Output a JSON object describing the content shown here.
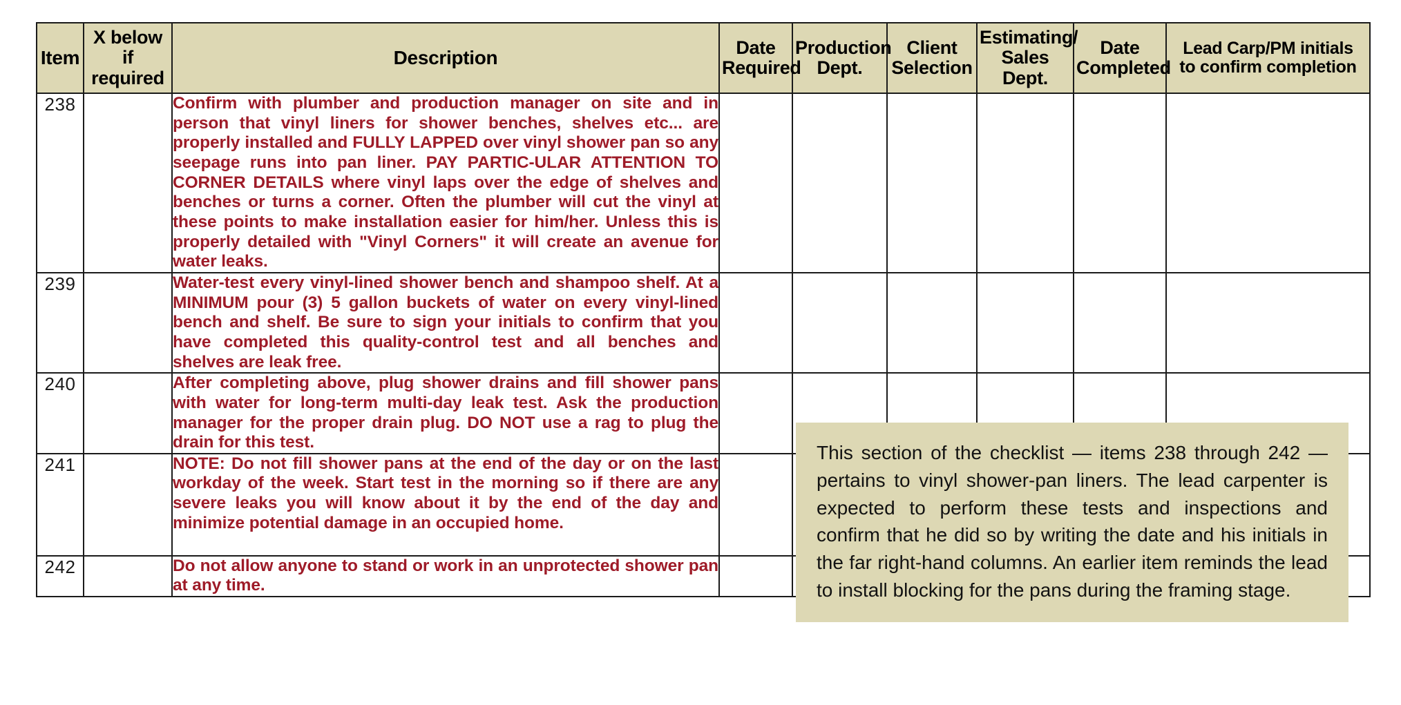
{
  "table": {
    "headers": {
      "item": "Item",
      "x_required": "X below if\nrequired",
      "description": "Description",
      "date_required": "Date\nRequired",
      "production_dept": "Production\nDept.",
      "client_selection": "Client\nSelection",
      "estimating_sales": "Estimating/\nSales Dept.",
      "date_completed": "Date\nCompleted",
      "lead_initials": "Lead Carp/PM  initials\nto confirm completion"
    },
    "header_lines": {
      "item": [
        "Item"
      ],
      "x_required": [
        "X below  if",
        "required"
      ],
      "description": [
        "Description"
      ],
      "date_required": [
        "Date",
        "Required"
      ],
      "production_dept": [
        "Production",
        "Dept."
      ],
      "client_selection": [
        "Client",
        "Selection"
      ],
      "estimating_sales": [
        "Estimating/",
        "Sales Dept."
      ],
      "date_completed": [
        "Date",
        "Completed"
      ],
      "lead_initials": [
        "Lead Carp/PM  initials",
        "to confirm completion"
      ]
    },
    "rows": [
      {
        "item": "238",
        "x_required": "",
        "description": "Confirm with  plumber  and  production manager  on site and  in person that  vinyl liners for shower benches, shelves etc... are properly installed and FULLY LAPPED over vinyl shower pan so any seepage runs into pan liner.  PAY PARTIC-ULAR ATTENTION  TO CORNER DETAILS where   vinyl   laps  over  the  edge  of  shelves and benches or turns a corner. Often the plumber will cut the vinyl at these points to make installation easier for him/her.  Unless this is properly  detailed with \"Vinyl Corners\" it will  create an avenue for water leaks.",
        "date_required": "",
        "production_dept": "",
        "client_selection": "",
        "estimating_sales": "",
        "date_completed": "",
        "lead_initials": ""
      },
      {
        "item": "239",
        "x_required": "",
        "description": "Water-test every vinyl-lined   shower bench and shampoo shelf. At a MINIMUM pour (3)  5 gallon buckets of water  on every vinyl-lined  bench and shelf. Be sure to sign your initials  to confirm that  you have completed this quality-control test and all benches and shelves are leak free.",
        "date_required": "",
        "production_dept": "",
        "client_selection": "",
        "estimating_sales": "",
        "date_completed": "",
        "lead_initials": ""
      },
      {
        "item": "240",
        "x_required": "",
        "description": "After completing above, plug shower drains and fill shower pans with  water for long-term  multi-day  leak test. Ask the  production  manager  for the  proper drain  plug.  DO NOT use a rag to plug the  drain  for this test.",
        "date_required": "",
        "production_dept": "",
        "client_selection": "",
        "estimating_sales": "",
        "date_completed": "",
        "lead_initials": ""
      },
      {
        "item": "241",
        "x_required": "",
        "description": "NOTE: Do not fill shower pans at the  end of the  day or on the  last workday  of the week.  Start test in the morning so if there are any severe leaks you will know about it by the end of the day and minimize potential  damage in an occupied home.",
        "date_required": "",
        "production_dept": "",
        "client_selection": "",
        "estimating_sales": "",
        "date_completed": "",
        "lead_initials": ""
      },
      {
        "item": "242",
        "x_required": "",
        "description": "Do not allow anyone to stand or work in an unprotected shower pan at any time.",
        "date_required": "",
        "production_dept": "",
        "client_selection": "",
        "estimating_sales": "",
        "date_completed": "",
        "lead_initials": ""
      }
    ]
  },
  "callout": {
    "text": "This  section of the  checklist — items 238  through  242  — pertains to vinyl shower-pan liners.  The  lead carpenter is expected to  perform these tests and inspections and  confirm that he did  so by  writing the  date and  his  initials in  the  far right-hand columns. An  earlier item  reminds the  lead  to install blocking for the  pans  during  the  framing stage."
  },
  "colors": {
    "header_fill": "#ddd8b4",
    "callout_fill": "#ddd8b4",
    "description_text": "#9e1b28",
    "border": "#1a1a1a",
    "body_fill": "#ffffff"
  }
}
